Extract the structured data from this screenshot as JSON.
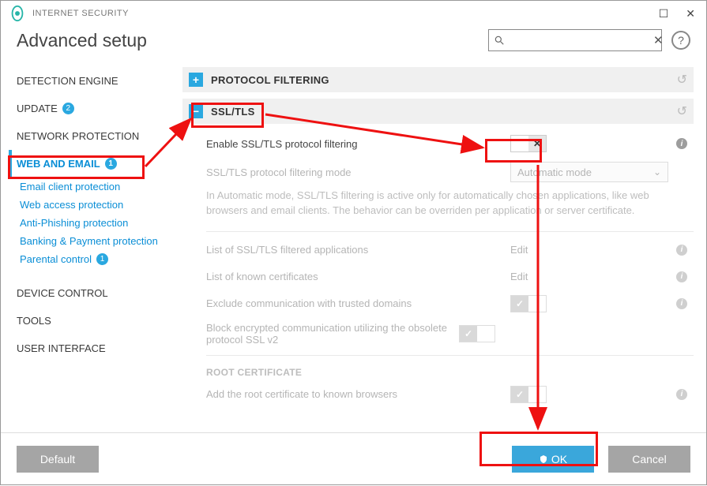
{
  "app": {
    "product": "INTERNET SECURITY",
    "title": "Advanced setup"
  },
  "window": {
    "max_icon": "☐",
    "close_icon": "✕"
  },
  "search": {
    "placeholder": "",
    "value": ""
  },
  "sidebar": {
    "items": [
      {
        "label": "DETECTION ENGINE"
      },
      {
        "label": "UPDATE",
        "badge": "2"
      },
      {
        "label": "NETWORK PROTECTION"
      },
      {
        "label": "WEB AND EMAIL",
        "badge": "1",
        "active": true
      },
      {
        "label": "DEVICE CONTROL"
      },
      {
        "label": "TOOLS"
      },
      {
        "label": "USER INTERFACE"
      }
    ],
    "sub": [
      {
        "label": "Email client protection"
      },
      {
        "label": "Web access protection"
      },
      {
        "label": "Anti-Phishing protection"
      },
      {
        "label": "Banking & Payment protection"
      },
      {
        "label": "Parental control",
        "badge": "1"
      }
    ]
  },
  "sections": {
    "protocol": {
      "title": "PROTOCOL FILTERING",
      "icon": "+"
    },
    "ssl": {
      "title": "SSL/TLS",
      "icon": "−",
      "rows": {
        "enable": "Enable SSL/TLS protocol filtering",
        "mode_label": "SSL/TLS protocol filtering mode",
        "mode_value": "Automatic mode",
        "desc": "In Automatic mode, SSL/TLS filtering is active only for automatically chosen applications, like web browsers and email clients. The behavior can be overriden per application or server certificate.",
        "filtered_apps": "List of SSL/TLS filtered applications",
        "known_certs": "List of known certificates",
        "edit": "Edit",
        "exclude_trusted": "Exclude communication with trusted domains",
        "block_sslv2": "Block encrypted communication utilizing the obsolete protocol SSL v2",
        "rootcert_hdr": "ROOT CERTIFICATE",
        "rootcert_add": "Add the root certificate to known browsers"
      }
    }
  },
  "buttons": {
    "default": "Default",
    "ok": "OK",
    "cancel": "Cancel"
  },
  "icons": {
    "x": "✕",
    "check": "✓",
    "chevron": "⌄"
  }
}
